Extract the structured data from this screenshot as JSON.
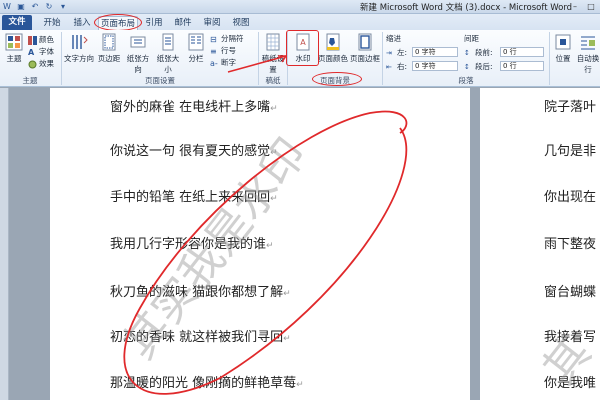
{
  "window": {
    "title": "新建 Microsoft Word 文档 (3).docx - Microsoft Word"
  },
  "tabs": [
    {
      "label": "文件"
    },
    {
      "label": "开始"
    },
    {
      "label": "插入"
    },
    {
      "label": "页面布局"
    },
    {
      "label": "引用"
    },
    {
      "label": "邮件"
    },
    {
      "label": "审阅"
    },
    {
      "label": "视图"
    }
  ],
  "ribbon": {
    "theme_group": {
      "theme_label": "主题",
      "colors_label": "颜色",
      "fonts_label": "字体",
      "effects_label": "效果",
      "group_label": "主题"
    },
    "page_setup_group": {
      "text_direction": "文字方向",
      "margins": "页边距",
      "orientation": "纸张方向",
      "size": "纸张大小",
      "columns": "分栏",
      "breaks": "分隔符",
      "line_numbers": "行号",
      "hyphenation": "断字",
      "group_label": "页面设置"
    },
    "draft_group": {
      "page_setup_btn": "稿纸设置",
      "group_label": "稿纸"
    },
    "page_bg_group": {
      "watermark": "水印",
      "page_color": "页面颜色",
      "page_border": "页面边框",
      "group_label": "页面背景"
    },
    "paragraph_group": {
      "indent_label": "缩进",
      "spacing_label": "间距",
      "left_label": "左:",
      "right_label": "右:",
      "before_label": "段前:",
      "after_label": "段后:",
      "left_value": "0 字符",
      "right_value": "0 字符",
      "before_value": "0 行",
      "after_value": "0 行",
      "group_label": "段落"
    },
    "arrange_group": {
      "position": "位置",
      "wrap_text": "自动换行"
    }
  },
  "document": {
    "lines": [
      "窗外的麻雀  在电线杆上多嘴",
      "你说这一句  很有夏天的感觉",
      "手中的铅笔  在纸上来来回回",
      "我用几行字形容你是我的谁",
      "秋刀鱼的滋味  猫跟你都想了解",
      "初恋的香味  就这样被我们寻回",
      "那温暖的阳光  像刚摘的鲜艳草莓"
    ],
    "page2_lines": [
      "院子落叶",
      "几句是非",
      "你出现在",
      "雨下整夜",
      "窗台蝴蝶",
      "我接着写",
      "你是我唯"
    ],
    "paragraph_mark": "↵",
    "watermark_text": "其实我是水印",
    "watermark_partial": "其"
  },
  "colors": {
    "accent": "#2a5699",
    "annotation": "#e0292b"
  }
}
